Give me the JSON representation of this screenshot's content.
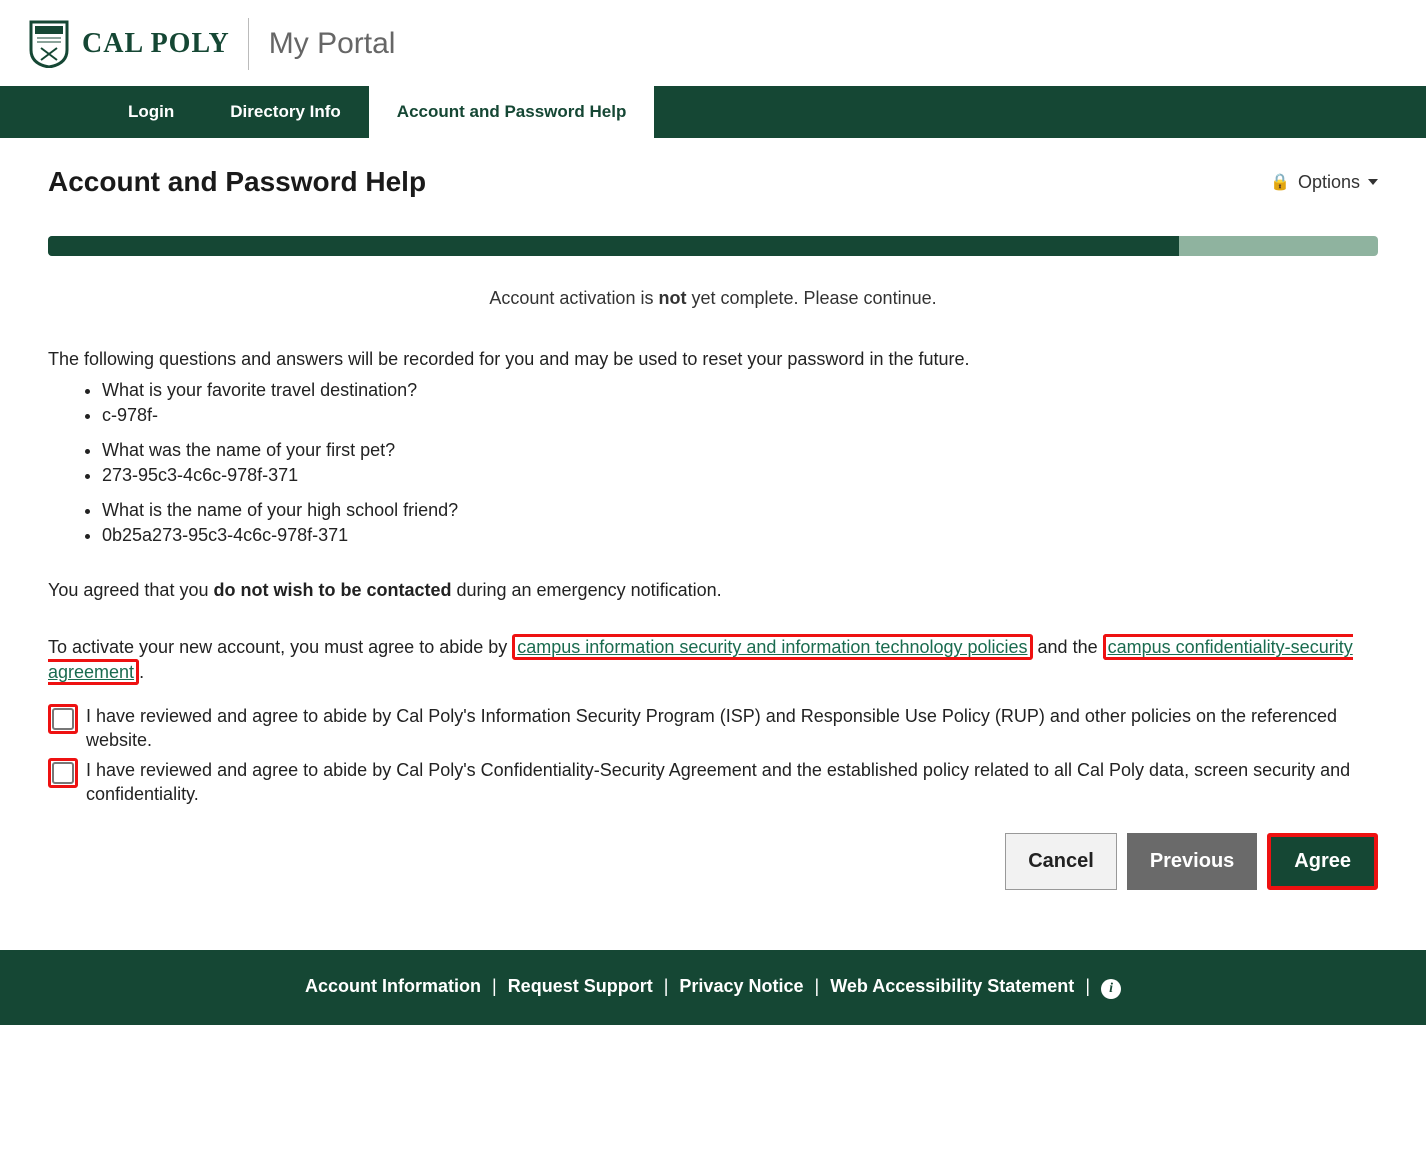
{
  "header": {
    "logo_text": "CAL POLY",
    "portal_title": "My Portal"
  },
  "nav": {
    "tabs": [
      {
        "label": "Login",
        "active": false
      },
      {
        "label": "Directory Info",
        "active": false
      },
      {
        "label": "Account and Password Help",
        "active": true
      }
    ]
  },
  "page": {
    "title": "Account and Password Help",
    "options_label": "Options",
    "progress_percent": 85,
    "status_prefix": "Account activation is ",
    "status_bold": "not",
    "status_suffix": " yet complete. Please continue.",
    "intro": "The following questions and answers will be recorded for you and may be used to reset your password in the future.",
    "qa": [
      {
        "q": "What is your favorite travel destination?",
        "a": "c-978f-"
      },
      {
        "q": "What was the name of your first pet?",
        "a": "273-95c3-4c6c-978f-371"
      },
      {
        "q": "What is the name of your high school friend?",
        "a": "0b25a273-95c3-4c6c-978f-371"
      }
    ],
    "emergency_prefix": "You agreed that you ",
    "emergency_bold": "do not wish to be contacted",
    "emergency_suffix": " during an emergency notification.",
    "activate_prefix": "To activate your new account, you must agree to abide by ",
    "link1": "campus information security and information technology policies",
    "activate_mid": " and the ",
    "link2": "campus confidentiality-security agreement",
    "activate_end": ".",
    "agreements": [
      "I have reviewed and agree to abide by Cal Poly's Information Security Program (ISP) and Responsible Use Policy (RUP) and other policies on the referenced website.",
      "I have reviewed and agree to abide by Cal Poly's Confidentiality-Security Agreement and the established policy related to all Cal Poly data, screen security and confidentiality."
    ],
    "buttons": {
      "cancel": "Cancel",
      "previous": "Previous",
      "agree": "Agree"
    }
  },
  "footer": {
    "links": [
      "Account Information",
      "Request Support",
      "Privacy Notice",
      "Web Accessibility Statement"
    ]
  }
}
